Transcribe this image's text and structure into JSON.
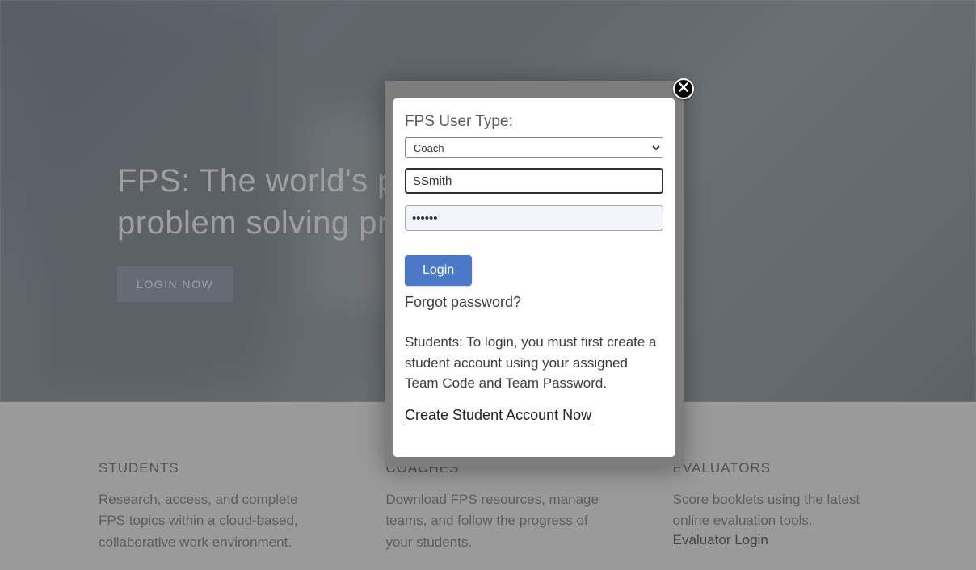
{
  "hero": {
    "line1": "FPS: The world's pre",
    "line2": "problem solving prog",
    "login_now": "LOGIN NOW"
  },
  "footer": {
    "students": {
      "heading": "STUDENTS",
      "body": "Research, access, and complete FPS topics within a cloud-based, collaborative work environment."
    },
    "coaches": {
      "heading": "COACHES",
      "body": "Download FPS resources, manage teams, and follow the progress of your students."
    },
    "evaluators": {
      "heading": "EVALUATORS",
      "body": "Score booklets using the latest online evaluation tools.",
      "link": "Evaluator Login"
    }
  },
  "modal": {
    "user_type_label": "FPS User Type:",
    "user_type_value": "Coach",
    "username_value": "SSmith",
    "password_value": "••••••",
    "login_button": "Login",
    "forgot": "Forgot password?",
    "student_msg": "Students: To login, you must first create a student account using your assigned Team Code and Team Password.",
    "create_link": "Create Student Account Now"
  }
}
